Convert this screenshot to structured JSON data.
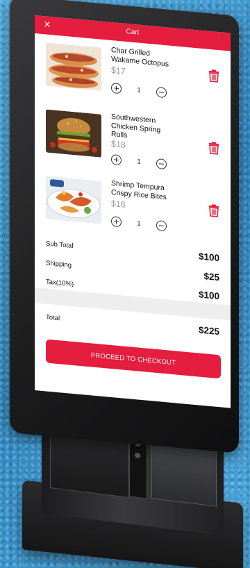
{
  "header": {
    "title": "Cart",
    "close_icon": "close-icon",
    "bg_color": "#e51d3e"
  },
  "items": [
    {
      "name_lines": [
        "Char Grilled",
        "Wakame Octopus"
      ],
      "price": "$17",
      "quantity": "1",
      "image": "hot-dogs-photo"
    },
    {
      "name_lines": [
        "Southwestern",
        "Chicken Spring",
        "Rolls"
      ],
      "price": "$18",
      "quantity": "1",
      "image": "burger-photo"
    },
    {
      "name_lines": [
        "Shrimp Tempura",
        "Crispy Rice Bites"
      ],
      "price": "$16",
      "quantity": "1",
      "image": "seafood-platter-photo"
    }
  ],
  "summary": {
    "subtotal_label": "Sub Total",
    "subtotal_value": "$100",
    "shipping_label": "Shipping",
    "shipping_value": "$25",
    "tax_label": "Tax(10%)",
    "tax_value": "$100",
    "total_label": "Total",
    "total_value": "$225"
  },
  "checkout": {
    "label": "PROCEED TO CHECKOUT"
  },
  "colors": {
    "accent": "#e51d3e",
    "price_gray": "#9a9a9a",
    "background": "#3b95c8"
  }
}
